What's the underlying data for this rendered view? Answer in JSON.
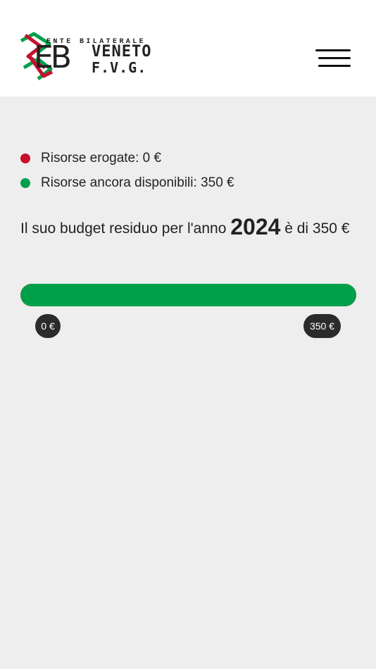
{
  "header": {
    "logo": {
      "tagline": "ENTE BILATERALE",
      "initials": "EB",
      "line1": "VENETO",
      "line2": "F.V.G.",
      "colors": {
        "red": "#c8102e",
        "green": "#00a04a"
      }
    },
    "menu_icon": "hamburger-icon"
  },
  "legend": {
    "items": [
      {
        "label": "Risorse erogate: 0 €",
        "color": "#c8102e"
      },
      {
        "label": "Risorse ancora disponibili: 350 €",
        "color": "#00a04a"
      }
    ]
  },
  "summary": {
    "prefix": "Il suo budget residuo per l'anno ",
    "year": "2024",
    "suffix": " è di 350 €"
  },
  "budget": {
    "total": 350,
    "spent": 0,
    "available": 350,
    "min_label": "0 €",
    "max_label": "350 €",
    "spent_color": "#c8102e",
    "available_color": "#00a04a"
  }
}
